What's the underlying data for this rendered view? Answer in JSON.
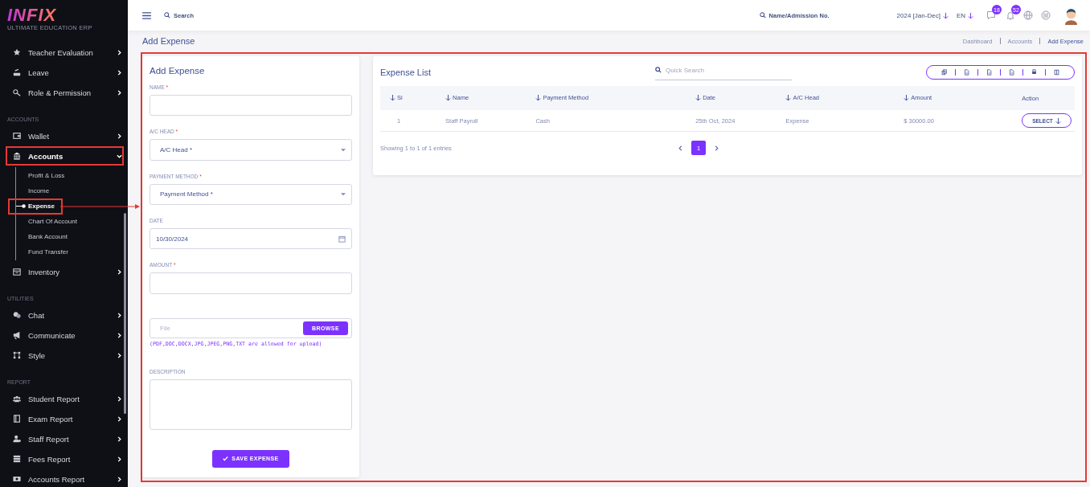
{
  "logo": {
    "title": "INFIX",
    "subtitle": "ULTIMATE EDUCATION ERP"
  },
  "sidebar": {
    "sections": [
      {
        "items": [
          {
            "label": "Teacher Evaluation",
            "expanded": false,
            "highlighted": false
          },
          {
            "label": "Leave",
            "expanded": false,
            "highlighted": false
          },
          {
            "label": "Role & Permission",
            "expanded": false,
            "highlighted": false
          }
        ]
      },
      {
        "heading": "ACCOUNTS",
        "items": [
          {
            "label": "Wallet",
            "expanded": false,
            "highlighted": false
          },
          {
            "label": "Accounts",
            "expanded": true,
            "highlighted": true,
            "children": [
              {
                "label": "Profit & Loss",
                "selected": false,
                "highlighted": false
              },
              {
                "label": "Income",
                "selected": false,
                "highlighted": false
              },
              {
                "label": "Expense",
                "selected": true,
                "highlighted": true
              },
              {
                "label": "Chart Of Account",
                "selected": false,
                "highlighted": false
              },
              {
                "label": "Bank Account",
                "selected": false,
                "highlighted": false
              },
              {
                "label": "Fund Transfer",
                "selected": false,
                "highlighted": false
              }
            ]
          },
          {
            "label": "Inventory",
            "expanded": false,
            "highlighted": false
          }
        ]
      },
      {
        "heading": "UTILITIES",
        "items": [
          {
            "label": "Chat",
            "expanded": false,
            "highlighted": false
          },
          {
            "label": "Communicate",
            "expanded": false,
            "highlighted": false
          },
          {
            "label": "Style",
            "expanded": false,
            "highlighted": false
          }
        ]
      },
      {
        "heading": "REPORT",
        "items": [
          {
            "label": "Student Report",
            "expanded": false,
            "highlighted": false
          },
          {
            "label": "Exam Report",
            "expanded": false,
            "highlighted": false
          },
          {
            "label": "Staff Report",
            "expanded": false,
            "highlighted": false
          },
          {
            "label": "Fees Report",
            "expanded": false,
            "highlighted": false
          },
          {
            "label": "Accounts Report",
            "expanded": false,
            "highlighted": false
          }
        ]
      }
    ]
  },
  "topbar": {
    "search_label": "Search",
    "student_search": "Name/Admission No.",
    "year": "2024 [Jan-Dec]",
    "language": "EN",
    "messages_badge": "18",
    "notifications_badge": "52"
  },
  "page_title": "Add Expense",
  "breadcrumb": [
    "Dashboard",
    "Accounts",
    "Add Expense"
  ],
  "form": {
    "title": "Add Expense",
    "fields": [
      {
        "kind": "text",
        "label": "NAME",
        "mark": "*"
      },
      {
        "kind": "select",
        "label": "A/C HEAD",
        "mark": "*",
        "placeholder": "A/C Head *"
      },
      {
        "kind": "select",
        "label": "PAYMENT METHOD",
        "mark": "*",
        "placeholder": "Payment Method *"
      },
      {
        "kind": "date",
        "label": "DATE",
        "value": "10/30/2024"
      },
      {
        "kind": "text",
        "label": "AMOUNT",
        "mark": "*"
      },
      {
        "kind": "file",
        "placeholder": "File",
        "button": "BROWSE",
        "hint": "(PDF,DOC,DOCX,JPG,JPEG,PNG,TXT are allowed for upload)"
      },
      {
        "kind": "textarea",
        "label": "DESCRIPTION"
      }
    ],
    "submit": "SAVE EXPENSE"
  },
  "list": {
    "title": "Expense List",
    "search_placeholder": "Quick Search",
    "columns": [
      {
        "label": "Si",
        "sortable": true
      },
      {
        "label": "Name",
        "sortable": true
      },
      {
        "label": "Payment Method",
        "sortable": true
      },
      {
        "label": "Date",
        "sortable": true
      },
      {
        "label": "A/C Head",
        "sortable": true
      },
      {
        "label": "Amount",
        "sortable": true
      },
      {
        "label": "Action",
        "sortable": false
      }
    ],
    "rows": [
      {
        "cells": [
          "1",
          "Staff Payroll",
          "Cash",
          "25th Oct, 2024",
          "Expense",
          "$ 30000.00"
        ],
        "action": "SELECT"
      }
    ],
    "info": "Showing 1 to 1 of 1 entries",
    "pages": [
      {
        "label": "1",
        "selected": true
      }
    ]
  }
}
